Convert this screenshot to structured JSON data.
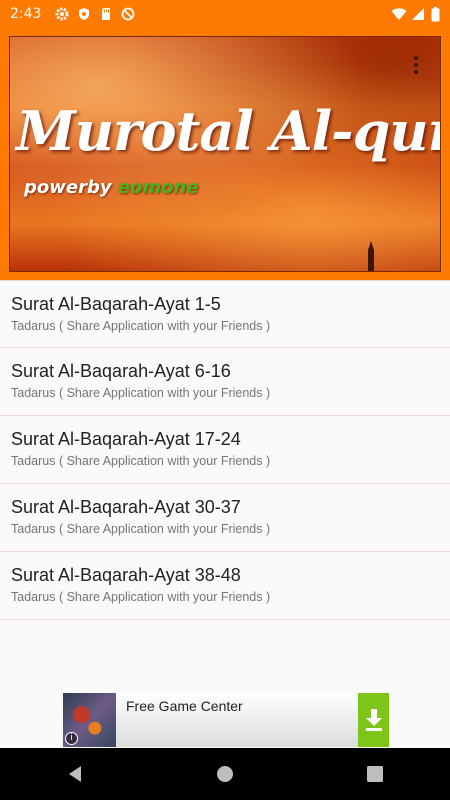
{
  "status_bar": {
    "time": "2:43",
    "left_icons": [
      "settings-icon",
      "shield-icon",
      "sd-card-icon",
      "no-data-icon"
    ],
    "right_icons": [
      "wifi-icon",
      "signal-icon",
      "battery-icon"
    ]
  },
  "header": {
    "banner_title": "Murotal Al-quran",
    "banner_sub_prefix": "powerby",
    "banner_sub_brand": "eomone",
    "menu_icon": "more-vert-icon"
  },
  "list": {
    "items": [
      {
        "title": "Surat Al-Baqarah-Ayat 1-5",
        "subtitle": "Tadarus ( Share Application with your Friends )"
      },
      {
        "title": "Surat Al-Baqarah-Ayat 6-16",
        "subtitle": "Tadarus ( Share Application with your Friends )"
      },
      {
        "title": "Surat Al-Baqarah-Ayat 17-24",
        "subtitle": "Tadarus ( Share Application with your Friends )"
      },
      {
        "title": "Surat Al-Baqarah-Ayat 30-37",
        "subtitle": "Tadarus ( Share Application with your Friends )"
      },
      {
        "title": "Surat Al-Baqarah-Ayat 38-48",
        "subtitle": "Tadarus ( Share Application with your Friends )"
      }
    ]
  },
  "ad": {
    "text": "Free Game Center",
    "info_label": "i",
    "download_icon": "download-icon"
  },
  "nav_bar": {
    "buttons": [
      "back-icon",
      "home-icon",
      "recents-icon"
    ]
  },
  "colors": {
    "accent": "#ff7a00",
    "ad_download": "#7ec51a",
    "brand_green": "#4caf20"
  }
}
